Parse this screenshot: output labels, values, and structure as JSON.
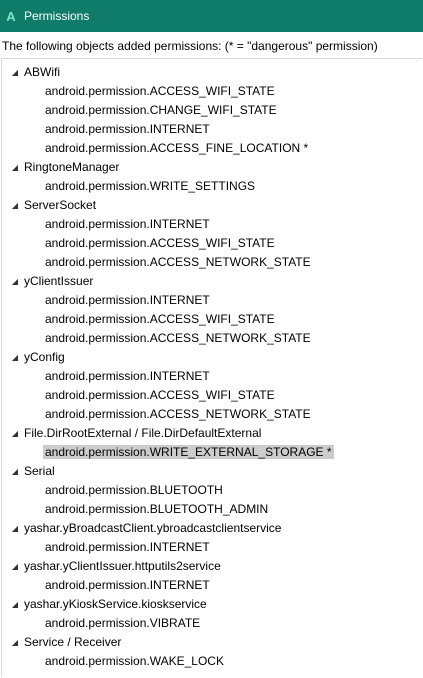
{
  "window": {
    "app_icon": "A",
    "title": "Permissions"
  },
  "description": "The following objects added permissions: (* = \"dangerous\" permission)",
  "tree": [
    {
      "label": "ABWifi",
      "expanded": true,
      "children": [
        "android.permission.ACCESS_WIFI_STATE",
        "android.permission.CHANGE_WIFI_STATE",
        "android.permission.INTERNET",
        "android.permission.ACCESS_FINE_LOCATION *"
      ]
    },
    {
      "label": "RingtoneManager",
      "expanded": true,
      "children": [
        "android.permission.WRITE_SETTINGS"
      ]
    },
    {
      "label": "ServerSocket",
      "expanded": true,
      "children": [
        "android.permission.INTERNET",
        "android.permission.ACCESS_WIFI_STATE",
        "android.permission.ACCESS_NETWORK_STATE"
      ]
    },
    {
      "label": "yClientIssuer",
      "expanded": true,
      "children": [
        "android.permission.INTERNET",
        "android.permission.ACCESS_WIFI_STATE",
        "android.permission.ACCESS_NETWORK_STATE"
      ]
    },
    {
      "label": "yConfig",
      "expanded": true,
      "children": [
        "android.permission.INTERNET",
        "android.permission.ACCESS_WIFI_STATE",
        "android.permission.ACCESS_NETWORK_STATE"
      ]
    },
    {
      "label": "File.DirRootExternal / File.DirDefaultExternal",
      "expanded": true,
      "children": [
        "android.permission.WRITE_EXTERNAL_STORAGE *"
      ],
      "selected_child": 0
    },
    {
      "label": "Serial",
      "expanded": true,
      "children": [
        "android.permission.BLUETOOTH",
        "android.permission.BLUETOOTH_ADMIN"
      ]
    },
    {
      "label": "yashar.yBroadcastClient.ybroadcastclientservice",
      "expanded": true,
      "children": [
        "android.permission.INTERNET"
      ]
    },
    {
      "label": "yashar.yClientIssuer.httputils2service",
      "expanded": true,
      "children": [
        "android.permission.INTERNET"
      ]
    },
    {
      "label": "yashar.yKioskService.kioskservice",
      "expanded": true,
      "children": [
        "android.permission.VIBRATE"
      ]
    },
    {
      "label": "Service / Receiver",
      "expanded": true,
      "children": [
        "android.permission.WAKE_LOCK"
      ]
    }
  ],
  "icons": {
    "expanded": "triangle-down-icon"
  },
  "colors": {
    "titlebar": "#0f7c69",
    "selection": "#cccccc"
  }
}
